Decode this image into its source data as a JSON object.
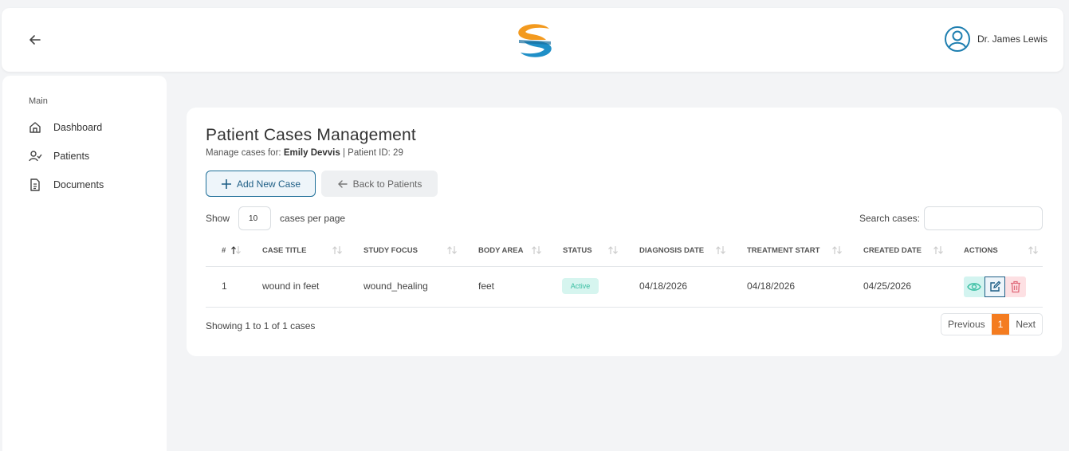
{
  "header": {
    "back_icon": "arrow-left-icon",
    "logo_icon": "s-logo-icon",
    "user_name": "Dr. James Lewis",
    "user_icon": "user-circle-icon"
  },
  "sidebar": {
    "section_label": "Main",
    "items": [
      {
        "label": "Dashboard",
        "icon": "home-icon"
      },
      {
        "label": "Patients",
        "icon": "user-check-icon"
      },
      {
        "label": "Documents",
        "icon": "document-icon"
      }
    ]
  },
  "main": {
    "title": "Patient Cases Management",
    "subtitle_prefix": "Manage cases for: ",
    "patient_name": "Emily Devvis",
    "patient_id_text": " | Patient ID: 29",
    "add_button": "Add New Case",
    "back_button": "Back to Patients",
    "show_label": "Show",
    "page_size": "10",
    "per_page_label": "cases per page",
    "search_label": "Search cases:",
    "search_value": "",
    "columns": [
      "#",
      "CASE TITLE",
      "STUDY FOCUS",
      "BODY AREA",
      "STATUS",
      "DIAGNOSIS DATE",
      "TREATMENT START",
      "CREATED DATE",
      "ACTIONS"
    ],
    "rows": [
      {
        "num": "1",
        "case_title": "wound in feet",
        "study_focus": "wound_healing",
        "body_area": "feet",
        "status": "Active",
        "diagnosis_date": "04/18/2026",
        "treatment_start": "04/18/2026",
        "created_date": "04/25/2026"
      }
    ],
    "showing_text": "Showing 1 to 1 of 1 cases",
    "pager": {
      "previous": "Previous",
      "current": "1",
      "next": "Next"
    }
  },
  "colors": {
    "accent_blue": "#1f5f86",
    "pager_active": "#f47c20",
    "status_active_bg": "#d6f5ef",
    "status_active_text": "#3bbfa3"
  }
}
